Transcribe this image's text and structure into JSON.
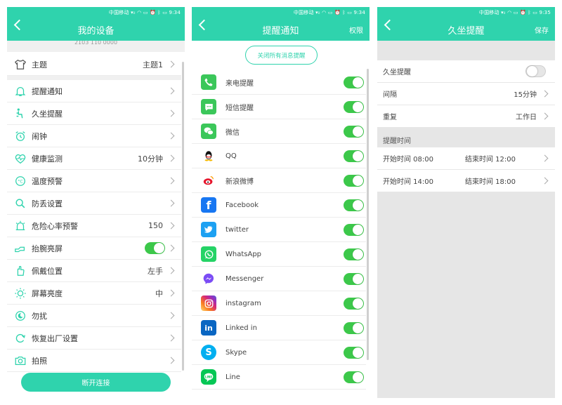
{
  "status_bars": [
    {
      "carrier": "中国移动",
      "time": "9:34"
    },
    {
      "carrier": "中国移动",
      "time": "9:34"
    },
    {
      "carrier": "中国移动",
      "time": "9:35"
    }
  ],
  "screen1": {
    "title": "我的设备",
    "mac_partial": "2103 110 0000",
    "rows": [
      {
        "label": "主题",
        "value": "主题1",
        "icon": "tshirt-icon"
      },
      {
        "label": "提醒通知",
        "value": "",
        "icon": "bell-icon"
      },
      {
        "label": "久坐提醒",
        "value": "",
        "icon": "sitting-icon"
      },
      {
        "label": "闹钟",
        "value": "",
        "icon": "alarm-clock-icon"
      },
      {
        "label": "健康监测",
        "value": "10分钟",
        "icon": "heartbeat-icon"
      },
      {
        "label": "温度预警",
        "value": "",
        "icon": "thermometer-icon"
      },
      {
        "label": "防丢设置",
        "value": "",
        "icon": "search-icon"
      },
      {
        "label": "危险心率预警",
        "value": "150",
        "icon": "alarm-light-icon"
      },
      {
        "label": "抬腕亮屏",
        "value": "",
        "icon": "wrist-icon",
        "toggle": true
      },
      {
        "label": "佩戴位置",
        "value": "左手",
        "icon": "hand-icon"
      },
      {
        "label": "屏幕亮度",
        "value": "中",
        "icon": "brightness-icon"
      },
      {
        "label": "勿扰",
        "value": "",
        "icon": "do-not-disturb-icon"
      },
      {
        "label": "恢复出厂设置",
        "value": "",
        "icon": "reset-icon"
      },
      {
        "label": "拍照",
        "value": "",
        "icon": "camera-icon"
      }
    ],
    "disconnect_label": "断开连接"
  },
  "screen2": {
    "title": "提醒通知",
    "action": "权限",
    "close_all_label": "关闭所有消息提醒",
    "apps": [
      {
        "name": "来电提醒",
        "icon": "phone-icon",
        "color": "#3bc75a"
      },
      {
        "name": "短信提醒",
        "icon": "message-icon",
        "color": "#3bc75a"
      },
      {
        "name": "微信",
        "icon": "wechat-icon",
        "color": "#3bc75a"
      },
      {
        "name": "QQ",
        "icon": "qq-icon",
        "color": "#ffffff"
      },
      {
        "name": "新浪微博",
        "icon": "weibo-icon",
        "color": "#ffffff"
      },
      {
        "name": "Facebook",
        "icon": "facebook-icon",
        "color": "#1877f2"
      },
      {
        "name": "twitter",
        "icon": "twitter-icon",
        "color": "#1da1f2"
      },
      {
        "name": "WhatsApp",
        "icon": "whatsapp-icon",
        "color": "#25d366"
      },
      {
        "name": "Messenger",
        "icon": "messenger-icon",
        "color": "#ffffff"
      },
      {
        "name": "instagram",
        "icon": "instagram-icon",
        "color": "#d62976"
      },
      {
        "name": "Linked in",
        "icon": "linkedin-icon",
        "color": "#0a66c2"
      },
      {
        "name": "Skype",
        "icon": "skype-icon",
        "color": "#00aff0"
      },
      {
        "name": "Line",
        "icon": "line-icon",
        "color": "#06c755"
      }
    ]
  },
  "screen3": {
    "title": "久坐提醒",
    "action": "保存",
    "sedentary_label": "久坐提醒",
    "interval_label": "间隔",
    "interval_value": "15分钟",
    "repeat_label": "重复",
    "repeat_value": "工作日",
    "section_label": "提醒时间",
    "periods": [
      {
        "start": "开始时间 08:00",
        "end": "结束时间 12:00"
      },
      {
        "start": "开始时间 14:00",
        "end": "结束时间 18:00"
      }
    ]
  },
  "colors": {
    "accent": "#2fd3ad",
    "toggle_on": "#3cc84a"
  }
}
